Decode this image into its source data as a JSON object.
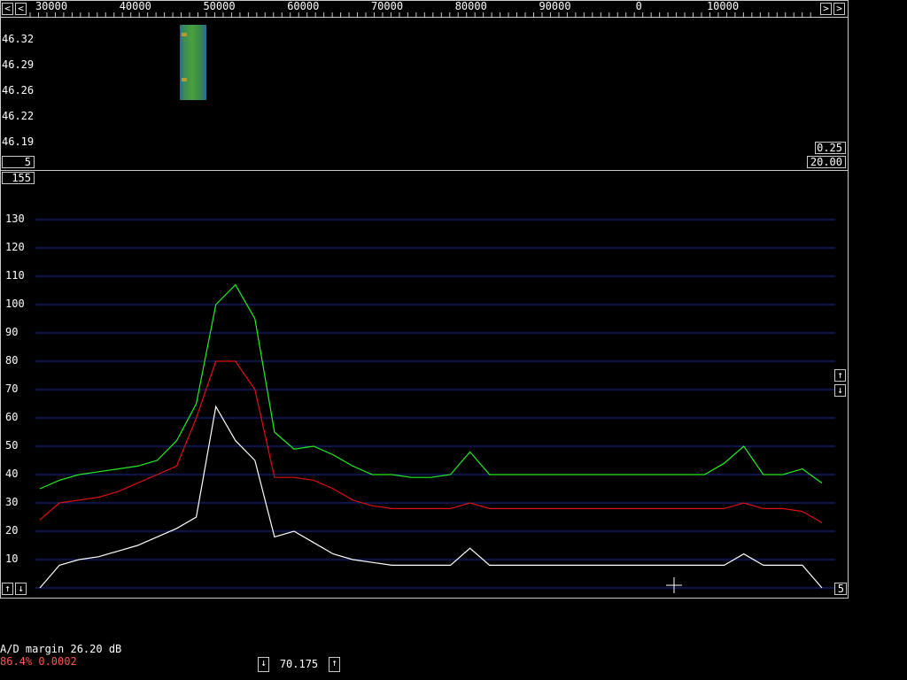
{
  "colors": {
    "background": "#000000",
    "frame": "#c8c8c8",
    "grid": "#1a2a9a",
    "avg_trace": "#22ee22",
    "mid_trace": "#dd1111",
    "spectrum_trace": "#ffffff",
    "status_red": "#ff5555"
  },
  "freq_scale": {
    "labels": [
      "30000",
      "40000",
      "50000",
      "60000",
      "70000",
      "80000",
      "90000",
      "0",
      "10000"
    ]
  },
  "waterfall": {
    "time_labels": [
      "46.32",
      "46.29",
      "46.26",
      "46.22",
      "46.19"
    ],
    "left_box": "5",
    "right_box_top": "0.25",
    "right_box_bottom": "20.00"
  },
  "spectrum": {
    "top_box": "155",
    "right_box": "5",
    "y_ticks": [
      "130",
      "120",
      "110",
      "100",
      "90",
      "80",
      "70",
      "60",
      "50",
      "40",
      "30",
      "20",
      "10"
    ]
  },
  "icons": {
    "scroll_left": "arrow-left-icon",
    "scroll_right": "arrow-right-icon",
    "up": "arrow-up-icon",
    "down": "arrow-down-icon",
    "cursor": "crosshair-icon"
  },
  "status": {
    "ad_margin": "A/D margin 26.20 dB",
    "cpu_load": "86.4% 0.0002",
    "frequency": "70.175"
  },
  "chart_data": {
    "type": "line",
    "x": [
      0,
      5,
      10,
      15,
      20,
      25,
      30,
      35,
      40,
      45,
      50,
      55,
      60,
      65,
      70,
      75,
      80,
      85,
      90,
      95,
      100,
      105,
      110,
      115,
      120,
      125,
      130,
      135,
      140,
      145,
      150,
      155,
      160,
      165,
      170,
      175,
      180,
      185,
      190,
      195,
      200
    ],
    "ylim": [
      0,
      155
    ],
    "series": [
      {
        "values": [
          35,
          38,
          40,
          41,
          42,
          43,
          45,
          52,
          65,
          100,
          107,
          95,
          55,
          49,
          50,
          47,
          43,
          40,
          40,
          39,
          39,
          40,
          48,
          40,
          40,
          40,
          40,
          40,
          40,
          40,
          40,
          40,
          40,
          40,
          40,
          44,
          50,
          40,
          40,
          42,
          37
        ]
      },
      {
        "values": [
          24,
          30,
          31,
          32,
          34,
          37,
          40,
          43,
          60,
          80,
          80,
          70,
          39,
          39,
          38,
          35,
          31,
          29,
          28,
          28,
          28,
          28,
          30,
          28,
          28,
          28,
          28,
          28,
          28,
          28,
          28,
          28,
          28,
          28,
          28,
          28,
          30,
          28,
          28,
          27,
          23
        ]
      },
      {
        "values": [
          0,
          8,
          10,
          11,
          13,
          15,
          18,
          21,
          25,
          64,
          52,
          45,
          18,
          20,
          16,
          12,
          10,
          9,
          8,
          8,
          8,
          8,
          14,
          8,
          8,
          8,
          8,
          8,
          8,
          8,
          8,
          8,
          8,
          8,
          8,
          8,
          12,
          8,
          8,
          8,
          0
        ]
      }
    ]
  }
}
